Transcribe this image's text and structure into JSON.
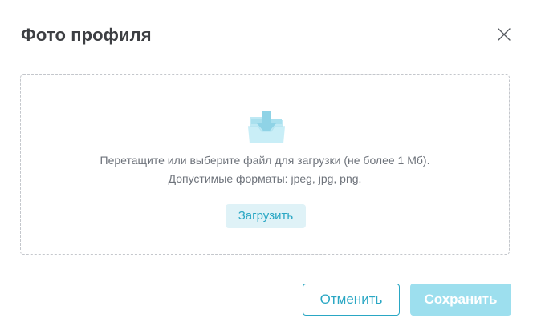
{
  "dialog": {
    "title": "Фото профиля",
    "close_icon": "close-icon"
  },
  "dropzone": {
    "icon": "folder-download-icon",
    "hint_line_1": "Перетащите или выберите файл для загрузки (не более 1 Мб).",
    "hint_line_2": "Допустимые форматы: jpeg, jpg, png.",
    "upload_label": "Загрузить"
  },
  "footer": {
    "cancel_label": "Отменить",
    "save_label": "Сохранить"
  },
  "colors": {
    "accent": "#2aa7c4",
    "accent_light": "#dff2f7",
    "save_disabled": "#9ddfee",
    "title_text": "#3d3f43",
    "hint_text": "#6e737b",
    "border_dashed": "#c4c7cc"
  }
}
